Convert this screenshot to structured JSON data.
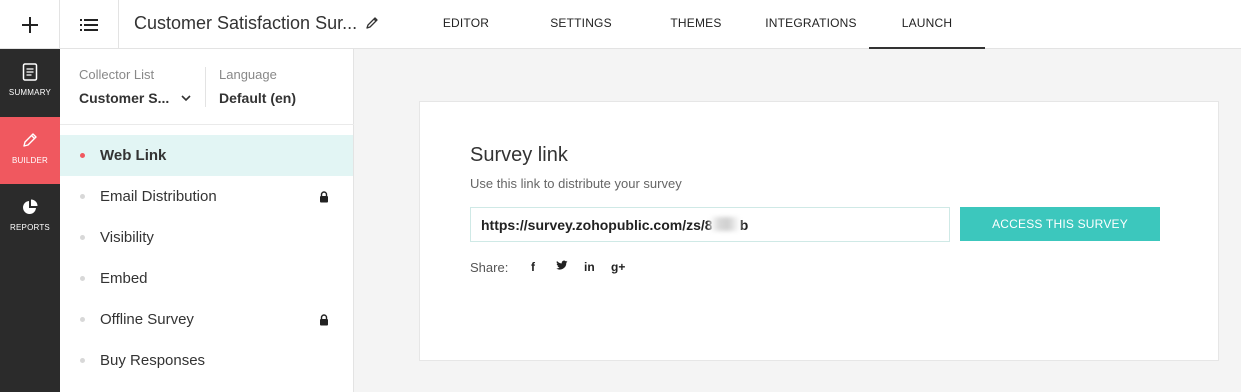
{
  "header": {
    "new_icon": "plus-icon",
    "menu_icon": "list-icon",
    "survey_title": "Customer Satisfaction Sur...",
    "edit_icon": "pencil-icon",
    "tabs": [
      {
        "label": "EDITOR"
      },
      {
        "label": "SETTINGS"
      },
      {
        "label": "THEMES"
      },
      {
        "label": "INTEGRATIONS"
      },
      {
        "label": "LAUNCH",
        "active": true
      }
    ]
  },
  "rail": {
    "items": [
      {
        "label": "SUMMARY",
        "icon": "document-icon"
      },
      {
        "label": "BUILDER",
        "icon": "pencil-icon",
        "active": true
      },
      {
        "label": "REPORTS",
        "icon": "pie-chart-icon"
      }
    ],
    "active_color": "#f0585f"
  },
  "panel": {
    "collector_label": "Collector List",
    "collector_value": "Customer S...",
    "language_label": "Language",
    "language_value": "Default (en)",
    "items": [
      {
        "label": "Web Link",
        "active": true
      },
      {
        "label": "Email Distribution",
        "locked": true
      },
      {
        "label": "Visibility"
      },
      {
        "label": "Embed"
      },
      {
        "label": "Offline Survey",
        "locked": true
      },
      {
        "label": "Buy Responses"
      }
    ]
  },
  "card": {
    "title": "Survey link",
    "subtitle": "Use this link to distribute your survey",
    "link_value": "https://survey.zohopublic.com/zs/8       b",
    "access_button": "ACCESS THIS SURVEY",
    "share_label": "Share:",
    "social": [
      "f",
      "t",
      "in",
      "g+"
    ],
    "accent_color": "#3cc7bd"
  }
}
